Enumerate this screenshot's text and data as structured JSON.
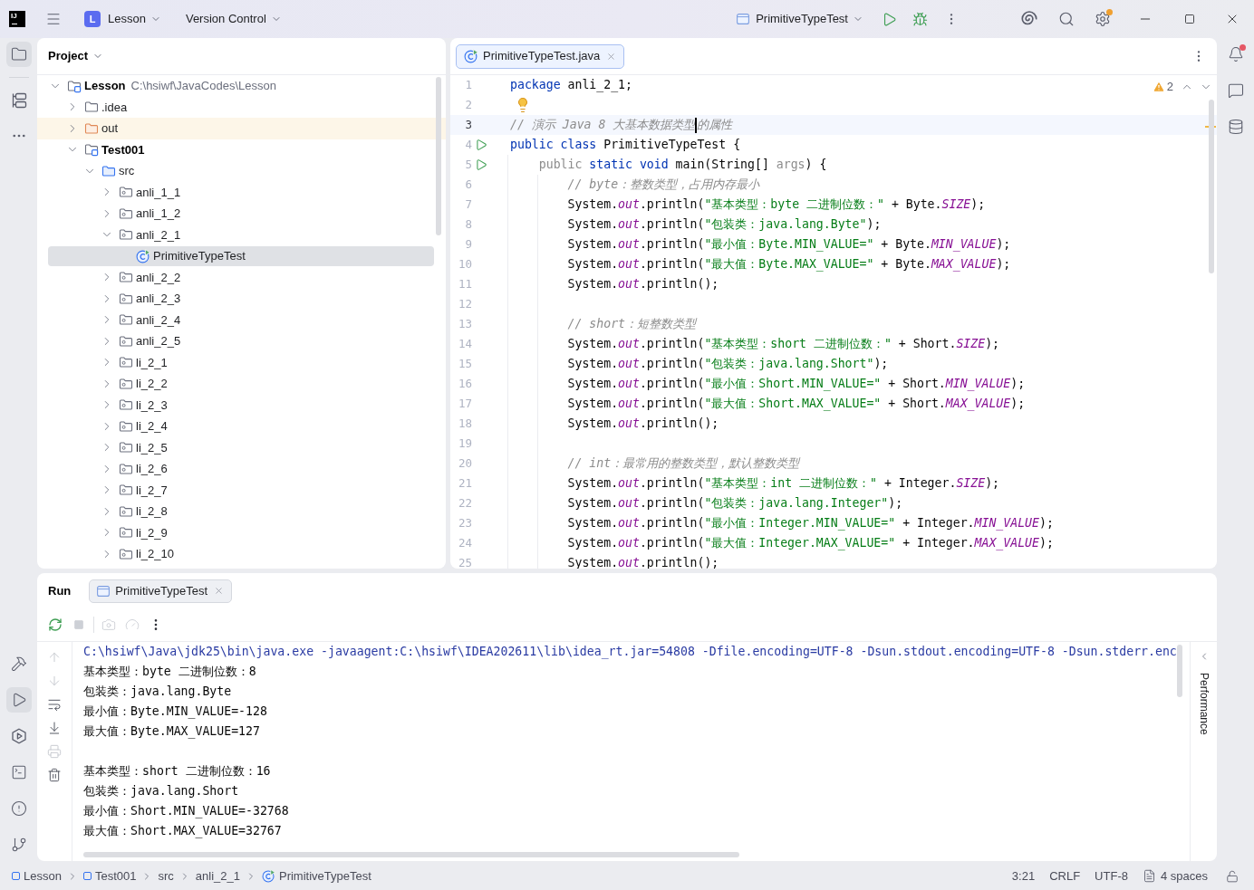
{
  "title_bar": {
    "logo": "IJ",
    "project": {
      "initial": "L",
      "name": "Lesson"
    },
    "vcs": "Version Control",
    "run_config": "PrimitiveTypeTest",
    "settings_badge": true
  },
  "left_toolbar": {
    "top": [
      {
        "kind": "project",
        "selected": true
      },
      {
        "kind": "structure",
        "selected": false
      }
    ],
    "bottom": [
      {
        "kind": "build",
        "selected": false
      },
      {
        "kind": "run",
        "selected": true
      },
      {
        "kind": "services",
        "selected": false
      },
      {
        "kind": "terminal",
        "selected": false
      },
      {
        "kind": "problems",
        "selected": false
      },
      {
        "kind": "git",
        "selected": false
      }
    ]
  },
  "project_panel": {
    "title": "Project",
    "tree": [
      {
        "label": "Lesson",
        "path": "C:\\hsiwf\\JavaCodes\\Lesson",
        "kind": "module",
        "expanded": true,
        "selected": false,
        "children": [
          {
            "label": ".idea",
            "kind": "folder",
            "expanded": false,
            "selected": false
          },
          {
            "label": "out",
            "kind": "excluded_folder",
            "expanded": false,
            "selected": false
          },
          {
            "label": "Test001",
            "kind": "module",
            "expanded": true,
            "selected": false,
            "children": [
              {
                "label": "src",
                "kind": "source_folder",
                "expanded": true,
                "selected": false,
                "children": [
                  {
                    "label": "anli_1_1",
                    "kind": "package",
                    "expanded": false,
                    "selected": false
                  },
                  {
                    "label": "anli_1_2",
                    "kind": "package",
                    "expanded": false,
                    "selected": false
                  },
                  {
                    "label": "anli_2_1",
                    "kind": "package",
                    "expanded": true,
                    "selected": false,
                    "children": [
                      {
                        "label": "PrimitiveTypeTest",
                        "kind": "class",
                        "selected": true
                      }
                    ]
                  },
                  {
                    "label": "anli_2_2",
                    "kind": "package",
                    "expanded": false,
                    "selected": false
                  },
                  {
                    "label": "anli_2_3",
                    "kind": "package",
                    "expanded": false,
                    "selected": false
                  },
                  {
                    "label": "anli_2_4",
                    "kind": "package",
                    "expanded": false,
                    "selected": false
                  },
                  {
                    "label": "anli_2_5",
                    "kind": "package",
                    "expanded": false,
                    "selected": false
                  },
                  {
                    "label": "li_2_1",
                    "kind": "package",
                    "expanded": false,
                    "selected": false
                  },
                  {
                    "label": "li_2_2",
                    "kind": "package",
                    "expanded": false,
                    "selected": false
                  },
                  {
                    "label": "li_2_3",
                    "kind": "package",
                    "expanded": false,
                    "selected": false
                  },
                  {
                    "label": "li_2_4",
                    "kind": "package",
                    "expanded": false,
                    "selected": false
                  },
                  {
                    "label": "li_2_5",
                    "kind": "package",
                    "expanded": false,
                    "selected": false
                  },
                  {
                    "label": "li_2_6",
                    "kind": "package",
                    "expanded": false,
                    "selected": false
                  },
                  {
                    "label": "li_2_7",
                    "kind": "package",
                    "expanded": false,
                    "selected": false
                  },
                  {
                    "label": "li_2_8",
                    "kind": "package",
                    "expanded": false,
                    "selected": false
                  },
                  {
                    "label": "li_2_9",
                    "kind": "package",
                    "expanded": false,
                    "selected": false
                  },
                  {
                    "label": "li_2_10",
                    "kind": "package",
                    "expanded": false,
                    "selected": false
                  }
                ]
              }
            ]
          }
        ]
      }
    ]
  },
  "editor": {
    "tabs": [
      {
        "label": "PrimitiveTypeTest.java",
        "selected": true
      }
    ],
    "warnings": "2",
    "lines": [
      {
        "number": "1",
        "kind": "code",
        "current": false,
        "tokens": [
          {
            "kind": "keyword",
            "text": "package"
          },
          {
            "kind": "plain",
            "text": " anli_2_1;"
          }
        ]
      },
      {
        "number": "2",
        "kind": "bulb",
        "current": false
      },
      {
        "number": "3",
        "kind": "code",
        "current": true,
        "tokens": [
          {
            "kind": "comment",
            "text": "// 演示 Java 8 大基本数据类型"
          },
          {
            "kind": "caret"
          },
          {
            "kind": "comment",
            "text": "的属性"
          }
        ]
      },
      {
        "number": "4",
        "kind": "run",
        "current": false,
        "tokens": [
          {
            "kind": "keyword",
            "text": "public class"
          },
          {
            "kind": "plain",
            "text": " PrimitiveTypeTest {"
          }
        ]
      },
      {
        "number": "5",
        "kind": "run",
        "current": false,
        "tokens": [
          {
            "kind": "muted",
            "text": "    public"
          },
          {
            "kind": "keyword",
            "text": " static void"
          },
          {
            "kind": "plain",
            "text": " main(String[] "
          },
          {
            "kind": "muted",
            "text": "args"
          },
          {
            "kind": "plain",
            "text": ") {"
          }
        ]
      },
      {
        "number": "6",
        "kind": "code",
        "current": false,
        "tokens": [
          {
            "kind": "comment",
            "text": "        // byte：整数类型，占用内存最小"
          }
        ]
      },
      {
        "number": "7",
        "kind": "code",
        "current": false,
        "tokens": [
          {
            "kind": "plain",
            "text": "        System."
          },
          {
            "kind": "field",
            "text": "out"
          },
          {
            "kind": "plain",
            "text": ".println("
          },
          {
            "kind": "string",
            "text": "\"基本类型：byte 二进制位数：\""
          },
          {
            "kind": "plain",
            "text": " + Byte."
          },
          {
            "kind": "field",
            "text": "SIZE"
          },
          {
            "kind": "plain",
            "text": ");"
          }
        ]
      },
      {
        "number": "8",
        "kind": "code",
        "current": false,
        "tokens": [
          {
            "kind": "plain",
            "text": "        System."
          },
          {
            "kind": "field",
            "text": "out"
          },
          {
            "kind": "plain",
            "text": ".println("
          },
          {
            "kind": "string",
            "text": "\"包装类：java.lang.Byte\""
          },
          {
            "kind": "plain",
            "text": ");"
          }
        ]
      },
      {
        "number": "9",
        "kind": "code",
        "current": false,
        "tokens": [
          {
            "kind": "plain",
            "text": "        System."
          },
          {
            "kind": "field",
            "text": "out"
          },
          {
            "kind": "plain",
            "text": ".println("
          },
          {
            "kind": "string",
            "text": "\"最小值：Byte.MIN_VALUE=\""
          },
          {
            "kind": "plain",
            "text": " + Byte."
          },
          {
            "kind": "field",
            "text": "MIN_VALUE"
          },
          {
            "kind": "plain",
            "text": ");"
          }
        ]
      },
      {
        "number": "10",
        "kind": "code",
        "current": false,
        "tokens": [
          {
            "kind": "plain",
            "text": "        System."
          },
          {
            "kind": "field",
            "text": "out"
          },
          {
            "kind": "plain",
            "text": ".println("
          },
          {
            "kind": "string",
            "text": "\"最大值：Byte.MAX_VALUE=\""
          },
          {
            "kind": "plain",
            "text": " + Byte."
          },
          {
            "kind": "field",
            "text": "MAX_VALUE"
          },
          {
            "kind": "plain",
            "text": ");"
          }
        ]
      },
      {
        "number": "11",
        "kind": "code",
        "current": false,
        "tokens": [
          {
            "kind": "plain",
            "text": "        System."
          },
          {
            "kind": "field",
            "text": "out"
          },
          {
            "kind": "plain",
            "text": ".println();"
          }
        ]
      },
      {
        "number": "12",
        "kind": "code",
        "current": false
      },
      {
        "number": "13",
        "kind": "code",
        "current": false,
        "tokens": [
          {
            "kind": "comment",
            "text": "        // short：短整数类型"
          }
        ]
      },
      {
        "number": "14",
        "kind": "code",
        "current": false,
        "tokens": [
          {
            "kind": "plain",
            "text": "        System."
          },
          {
            "kind": "field",
            "text": "out"
          },
          {
            "kind": "plain",
            "text": ".println("
          },
          {
            "kind": "string",
            "text": "\"基本类型：short 二进制位数：\""
          },
          {
            "kind": "plain",
            "text": " + Short."
          },
          {
            "kind": "field",
            "text": "SIZE"
          },
          {
            "kind": "plain",
            "text": ");"
          }
        ]
      },
      {
        "number": "15",
        "kind": "code",
        "current": false,
        "tokens": [
          {
            "kind": "plain",
            "text": "        System."
          },
          {
            "kind": "field",
            "text": "out"
          },
          {
            "kind": "plain",
            "text": ".println("
          },
          {
            "kind": "string",
            "text": "\"包装类：java.lang.Short\""
          },
          {
            "kind": "plain",
            "text": ");"
          }
        ]
      },
      {
        "number": "16",
        "kind": "code",
        "current": false,
        "tokens": [
          {
            "kind": "plain",
            "text": "        System."
          },
          {
            "kind": "field",
            "text": "out"
          },
          {
            "kind": "plain",
            "text": ".println("
          },
          {
            "kind": "string",
            "text": "\"最小值：Short.MIN_VALUE=\""
          },
          {
            "kind": "plain",
            "text": " + Short."
          },
          {
            "kind": "field",
            "text": "MIN_VALUE"
          },
          {
            "kind": "plain",
            "text": ");"
          }
        ]
      },
      {
        "number": "17",
        "kind": "code",
        "current": false,
        "tokens": [
          {
            "kind": "plain",
            "text": "        System."
          },
          {
            "kind": "field",
            "text": "out"
          },
          {
            "kind": "plain",
            "text": ".println("
          },
          {
            "kind": "string",
            "text": "\"最大值：Short.MAX_VALUE=\""
          },
          {
            "kind": "plain",
            "text": " + Short."
          },
          {
            "kind": "field",
            "text": "MAX_VALUE"
          },
          {
            "kind": "plain",
            "text": ");"
          }
        ]
      },
      {
        "number": "18",
        "kind": "code",
        "current": false,
        "tokens": [
          {
            "kind": "plain",
            "text": "        System."
          },
          {
            "kind": "field",
            "text": "out"
          },
          {
            "kind": "plain",
            "text": ".println();"
          }
        ]
      },
      {
        "number": "19",
        "kind": "code",
        "current": false
      },
      {
        "number": "20",
        "kind": "code",
        "current": false,
        "tokens": [
          {
            "kind": "comment",
            "text": "        // int：最常用的整数类型，默认整数类型"
          }
        ]
      },
      {
        "number": "21",
        "kind": "code",
        "current": false,
        "tokens": [
          {
            "kind": "plain",
            "text": "        System."
          },
          {
            "kind": "field",
            "text": "out"
          },
          {
            "kind": "plain",
            "text": ".println("
          },
          {
            "kind": "string",
            "text": "\"基本类型：int 二进制位数：\""
          },
          {
            "kind": "plain",
            "text": " + Integer."
          },
          {
            "kind": "field",
            "text": "SIZE"
          },
          {
            "kind": "plain",
            "text": ");"
          }
        ]
      },
      {
        "number": "22",
        "kind": "code",
        "current": false,
        "tokens": [
          {
            "kind": "plain",
            "text": "        System."
          },
          {
            "kind": "field",
            "text": "out"
          },
          {
            "kind": "plain",
            "text": ".println("
          },
          {
            "kind": "string",
            "text": "\"包装类：java.lang.Integer\""
          },
          {
            "kind": "plain",
            "text": ");"
          }
        ]
      },
      {
        "number": "23",
        "kind": "code",
        "current": false,
        "tokens": [
          {
            "kind": "plain",
            "text": "        System."
          },
          {
            "kind": "field",
            "text": "out"
          },
          {
            "kind": "plain",
            "text": ".println("
          },
          {
            "kind": "string",
            "text": "\"最小值：Integer.MIN_VALUE=\""
          },
          {
            "kind": "plain",
            "text": " + Integer."
          },
          {
            "kind": "field",
            "text": "MIN_VALUE"
          },
          {
            "kind": "plain",
            "text": ");"
          }
        ]
      },
      {
        "number": "24",
        "kind": "code",
        "current": false,
        "tokens": [
          {
            "kind": "plain",
            "text": "        System."
          },
          {
            "kind": "field",
            "text": "out"
          },
          {
            "kind": "plain",
            "text": ".println("
          },
          {
            "kind": "string",
            "text": "\"最大值：Integer.MAX_VALUE=\""
          },
          {
            "kind": "plain",
            "text": " + Integer."
          },
          {
            "kind": "field",
            "text": "MAX_VALUE"
          },
          {
            "kind": "plain",
            "text": ");"
          }
        ]
      },
      {
        "number": "25",
        "kind": "code",
        "current": false,
        "tokens": [
          {
            "kind": "plain",
            "text": "        System."
          },
          {
            "kind": "field",
            "text": "out"
          },
          {
            "kind": "plain",
            "text": ".println();"
          }
        ]
      }
    ]
  },
  "right_toolbar": [
    {
      "kind": "notifications",
      "selected": false,
      "badge": true
    },
    {
      "kind": "ai_chat",
      "selected": false,
      "badge": false
    },
    {
      "kind": "database",
      "selected": false,
      "badge": false
    }
  ],
  "run_panel": {
    "title": "Run",
    "tabs": [
      {
        "label": "PrimitiveTypeTest",
        "selected": true
      }
    ],
    "toolbar_groups": [
      [
        {
          "kind": "rerun",
          "disabled": false
        },
        {
          "kind": "stop",
          "disabled": true
        }
      ],
      [
        {
          "kind": "screenshot",
          "disabled": true
        },
        {
          "kind": "profiler",
          "disabled": true
        },
        {
          "kind": "more",
          "disabled": false
        }
      ]
    ],
    "side_toolbar": [
      {
        "kind": "up",
        "disabled": true
      },
      {
        "kind": "down",
        "disabled": true
      },
      {
        "kind": "soft_wrap",
        "disabled": false
      },
      {
        "kind": "scroll_to_end",
        "disabled": false
      },
      {
        "kind": "print",
        "disabled": true
      },
      {
        "kind": "clear",
        "disabled": false
      }
    ],
    "console": [
      {
        "kind": "command",
        "text": "C:\\hsiwf\\Java\\jdk25\\bin\\java.exe -javaagent:C:\\hsiwf\\IDEA202611\\lib\\idea_rt.jar=54808 -Dfile.encoding=UTF-8 -Dsun.stdout.encoding=UTF-8 -Dsun.stderr.enc"
      },
      {
        "kind": "output",
        "text": "基本类型：byte 二进制位数：8"
      },
      {
        "kind": "output",
        "text": "包装类：java.lang.Byte"
      },
      {
        "kind": "output",
        "text": "最小值：Byte.MIN_VALUE=-128"
      },
      {
        "kind": "output",
        "text": "最大值：Byte.MAX_VALUE=127"
      },
      {
        "kind": "blank"
      },
      {
        "kind": "output",
        "text": "基本类型：short 二进制位数：16"
      },
      {
        "kind": "output",
        "text": "包装类：java.lang.Short"
      },
      {
        "kind": "output",
        "text": "最小值：Short.MIN_VALUE=-32768"
      },
      {
        "kind": "output",
        "text": "最大值：Short.MAX_VALUE=32767"
      }
    ],
    "side_label": "Performance"
  },
  "status_bar": {
    "breadcrumbs": [
      {
        "kind": "module",
        "label": "Lesson"
      },
      {
        "kind": "module",
        "label": "Test001"
      },
      {
        "kind": "folder",
        "label": "src"
      },
      {
        "kind": "package",
        "label": "anli_2_1"
      },
      {
        "kind": "class",
        "label": "PrimitiveTypeTest"
      }
    ],
    "position": "3:21",
    "line_separator": "CRLF",
    "encoding": "UTF-8",
    "indent": "4 spaces"
  }
}
